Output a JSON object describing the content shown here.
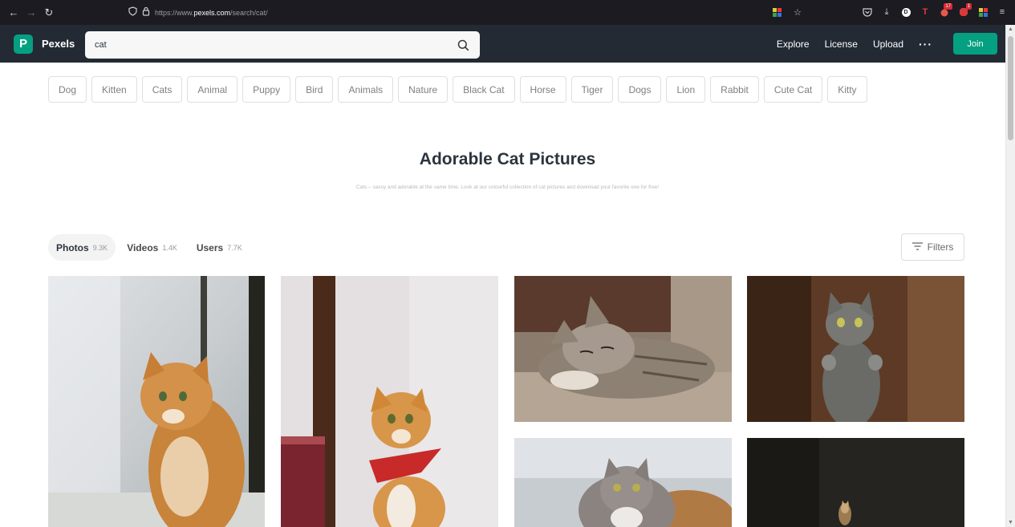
{
  "browser": {
    "url_prefix": "https://www.",
    "url_domain": "pexels.com",
    "url_path": "/search/cat/",
    "badges": [
      "17",
      "1"
    ]
  },
  "header": {
    "brand": "Pexels",
    "search_value": "cat",
    "nav": [
      "Explore",
      "License",
      "Upload"
    ],
    "more": "···",
    "join": "Join"
  },
  "chips": [
    "Dog",
    "Kitten",
    "Cats",
    "Animal",
    "Puppy",
    "Bird",
    "Animals",
    "Nature",
    "Black Cat",
    "Horse",
    "Tiger",
    "Dogs",
    "Lion",
    "Rabbit",
    "Cute Cat",
    "Kitty"
  ],
  "main": {
    "title": "Adorable Cat Pictures",
    "subtitle": "Cats – sassy and adorable at the same time. Look at our colourful collection of cat pictures and download your favorite one for free!"
  },
  "tabs": [
    {
      "label": "Photos",
      "count": "9.3K"
    },
    {
      "label": "Videos",
      "count": "1.4K"
    },
    {
      "label": "Users",
      "count": "7.7K"
    }
  ],
  "filters": {
    "label": "Filters"
  },
  "colors": {
    "brand": "#05a081",
    "header_bg": "#232a34",
    "browser_bg": "#1c1b22"
  },
  "icons": [
    "back-arrow-icon",
    "forward-arrow-icon",
    "reload-icon",
    "shield-icon",
    "lock-icon",
    "star-icon",
    "pocket-icon",
    "download-icon",
    "search-icon",
    "filter-icon"
  ]
}
